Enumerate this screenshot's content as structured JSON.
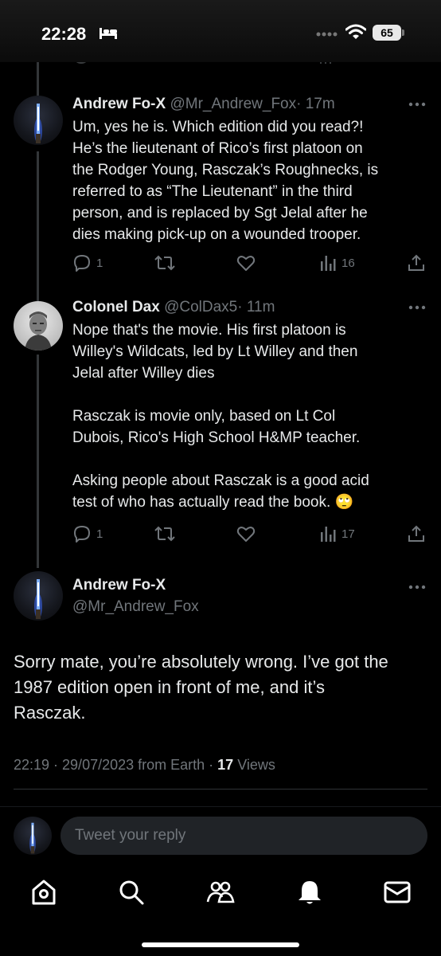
{
  "status_bar": {
    "time": "22:28",
    "battery_level": "65"
  },
  "tweets": [
    {
      "name": "Andrew Fo-X",
      "handle": "@Mr_Andrew_Fox",
      "time": "· 17m",
      "lines": [
        "Um, yes he is. Which edition did you read?!",
        "He’s the lieutenant of Rico’s first platoon on",
        "the Rodger Young, Rasczak’s Roughnecks, is",
        "referred to as “The Lieutenant” in the third",
        "person, and is replaced by Sgt Jelal after he",
        "dies making pick-up on a wounded trooper."
      ],
      "replies": "1",
      "views": "16"
    },
    {
      "name": "Colonel Dax",
      "handle": "@ColDax5",
      "time": "· 11m",
      "paragraphs": [
        [
          "Nope that's the movie. His first platoon is",
          "Willey's Wildcats, led by Lt Willey and then",
          "Jelal after Willey dies"
        ],
        [
          "Rasczak is movie only, based on Lt Col",
          "Dubois, Rico's High School H&MP teacher."
        ],
        [
          "Asking people about Rasczak is a good acid",
          "test of who has actually read the book. 🙄"
        ]
      ],
      "replies": "1",
      "views": "17"
    }
  ],
  "main_tweet": {
    "name": "Andrew Fo-X",
    "handle": "@Mr_Andrew_Fox",
    "lines": [
      "Sorry mate, you’re absolutely wrong. I’ve got the",
      "1987 edition open in front of me, and it’s",
      "Rasczak."
    ],
    "timestamp": "22:19 · 29/07/2023 from Earth · ",
    "views_count": "17",
    "views_label": " Views"
  },
  "reply_bar": {
    "placeholder": "Tweet your reply"
  },
  "tab_bar": {
    "icons": [
      "home-icon",
      "search-icon",
      "communities-icon",
      "notifications-icon",
      "messages-icon"
    ]
  },
  "colors": {
    "background": "#000000",
    "text": "#e7e9ea",
    "muted": "#71767b",
    "divider": "#2f3336",
    "input": "#202327"
  }
}
